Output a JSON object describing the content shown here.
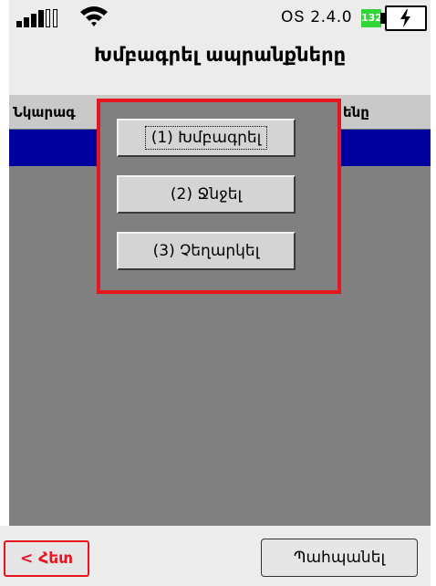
{
  "status_bar": {
    "os_version": "ՕՏ 2.4.0",
    "battery_level": "132"
  },
  "header": {
    "title": "Խմբագրել ապրանքները"
  },
  "list": {
    "columns": [
      "Նկարագ",
      "ենը"
    ]
  },
  "popup": {
    "edit_label": "(1) Խմբագրել",
    "delete_label": "(2) Ջնջել",
    "cancel_label": "(3) Չեղարկել"
  },
  "footer": {
    "back_label": "< Հետ",
    "save_label": "Պահպանել"
  },
  "colors": {
    "accent_red": "#e8141f",
    "selection_blue": "#00009e",
    "battery_green": "#33d43a"
  },
  "icons": [
    "signal-icon",
    "wifi-icon",
    "charging-icon"
  ]
}
